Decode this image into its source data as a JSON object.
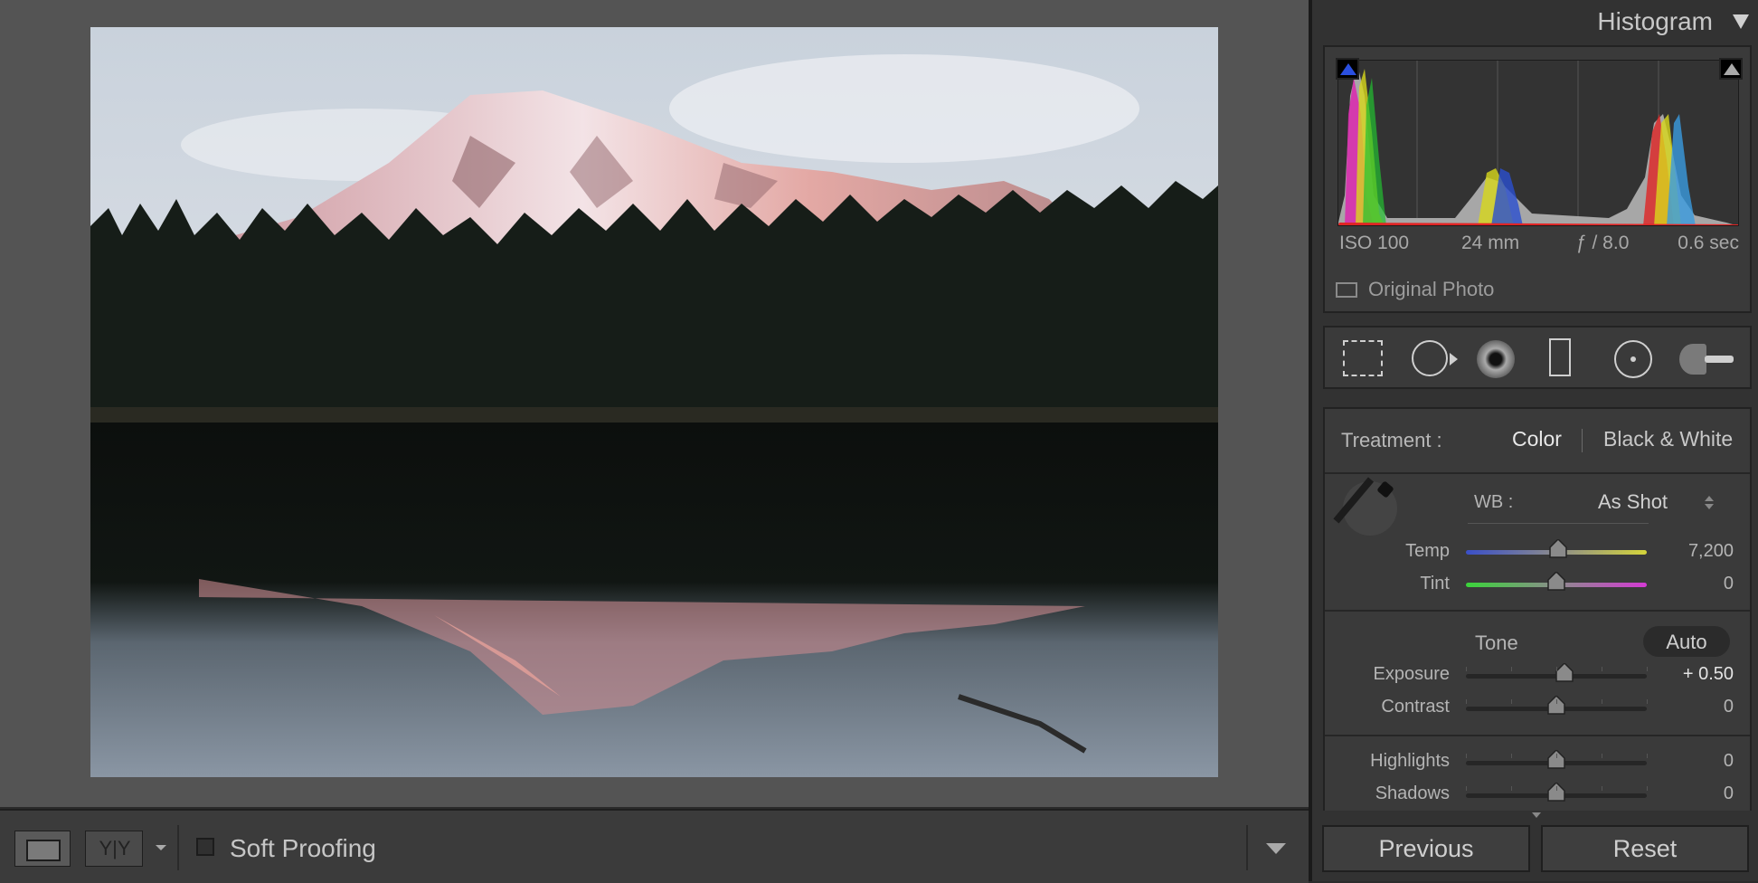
{
  "histogram": {
    "title": "Histogram",
    "iso": "ISO 100",
    "focal": "24 mm",
    "aperture": "ƒ / 8.0",
    "shutter": "0.6 sec",
    "original_photo_label": "Original Photo"
  },
  "treatment": {
    "label": "Treatment :",
    "color": "Color",
    "bw": "Black & White"
  },
  "wb": {
    "label": "WB :",
    "value": "As Shot",
    "temp_label": "Temp",
    "temp_value": "7,200",
    "tint_label": "Tint",
    "tint_value": "0"
  },
  "tone": {
    "label": "Tone",
    "auto": "Auto",
    "exposure_label": "Exposure",
    "exposure_value": "+ 0.50",
    "contrast_label": "Contrast",
    "contrast_value": "0",
    "highlights_label": "Highlights",
    "highlights_value": "0",
    "shadows_label": "Shadows",
    "shadows_value": "0"
  },
  "sliders": {
    "temp": 0.51,
    "tint": 0.5,
    "exposure": 0.545,
    "contrast": 0.5,
    "highlights": 0.5,
    "shadows": 0.5
  },
  "toolbar": {
    "compare_label": "Y|Y",
    "soft_proofing": "Soft Proofing"
  },
  "buttons": {
    "previous": "Previous",
    "reset": "Reset"
  },
  "colors": {
    "panel_bg": "#323232",
    "viewer_bg": "#545454"
  }
}
